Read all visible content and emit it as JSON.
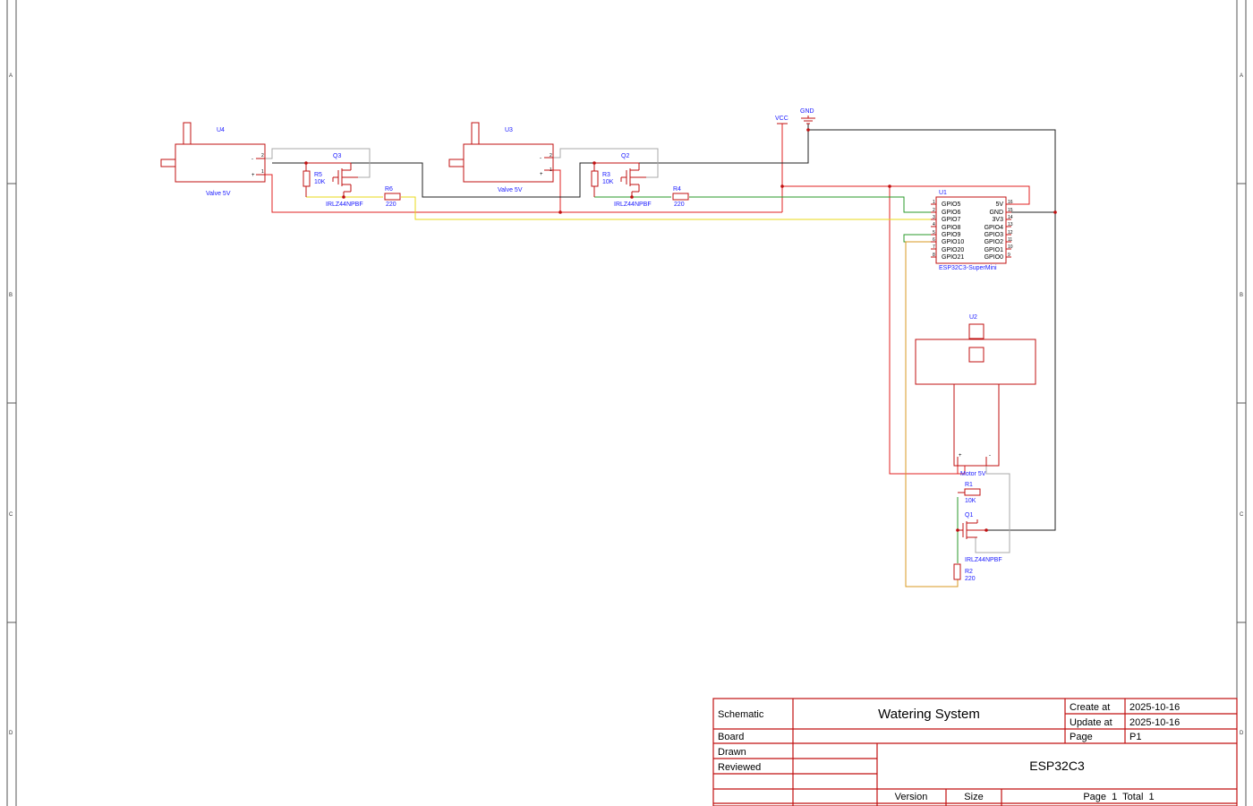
{
  "frame": {
    "zones": [
      "A",
      "B",
      "C",
      "D"
    ]
  },
  "components": {
    "u4": {
      "designator": "U4",
      "value": "Valve 5V"
    },
    "u3": {
      "designator": "U3",
      "value": "Valve 5V"
    },
    "u2": {
      "designator": "U2",
      "value": "Motor 5V"
    },
    "u1": {
      "designator": "U1",
      "value": "ESP32C3-SuperMini",
      "left_pins": [
        "GPIO5",
        "GPIO6",
        "GPIO7",
        "GPIO8",
        "GPIO9",
        "GPIO10",
        "GPIO20",
        "GPIO21"
      ],
      "left_nums": [
        "1",
        "2",
        "3",
        "4",
        "5",
        "6",
        "7",
        "8"
      ],
      "right_pins": [
        "5V",
        "GND",
        "3V3",
        "GPIO4",
        "GPIO3",
        "GPIO2",
        "GPIO1",
        "GPIO0"
      ],
      "right_nums": [
        "16",
        "15",
        "14",
        "13",
        "12",
        "11",
        "10",
        "9"
      ]
    },
    "q3": {
      "designator": "Q3",
      "value": "IRLZ44NPBF"
    },
    "q2": {
      "designator": "Q2",
      "value": "IRLZ44NPBF"
    },
    "q1": {
      "designator": "Q1",
      "value": "IRLZ44NPBF"
    },
    "r5": {
      "designator": "R5",
      "value": "10K"
    },
    "r6": {
      "designator": "R6",
      "value": "220"
    },
    "r3": {
      "designator": "R3",
      "value": "10K"
    },
    "r4": {
      "designator": "R4",
      "value": "220"
    },
    "r1": {
      "designator": "R1",
      "value": "10K"
    },
    "r2": {
      "designator": "R2",
      "value": "220"
    }
  },
  "power": {
    "vcc": "VCC",
    "gnd": "GND"
  },
  "pin_marks": {
    "plus": "+",
    "minus": "-",
    "one": "1",
    "two": "2"
  },
  "wire_colors": {
    "vcc": "#e02020",
    "gnd": "#202020",
    "ctrl1": "#e8d81a",
    "ctrl2": "#2a9a2a",
    "ctrl3": "#d89a20",
    "aux": "#a8a8a8",
    "symbol": "#c01010"
  },
  "title_block": {
    "schematic_label": "Schematic",
    "project_title": "Watering System",
    "create_label": "Create at",
    "create_date": "2025-10-16",
    "update_label": "Update at",
    "update_date": "2025-10-16",
    "board_label": "Board",
    "page_label": "Page",
    "page_value": "P1",
    "drawn_label": "Drawn",
    "reviewed_label": "Reviewed",
    "board_name": "ESP32C3",
    "version_label": "Version",
    "size_label": "Size",
    "page_total": "Page  1  Total  1"
  }
}
